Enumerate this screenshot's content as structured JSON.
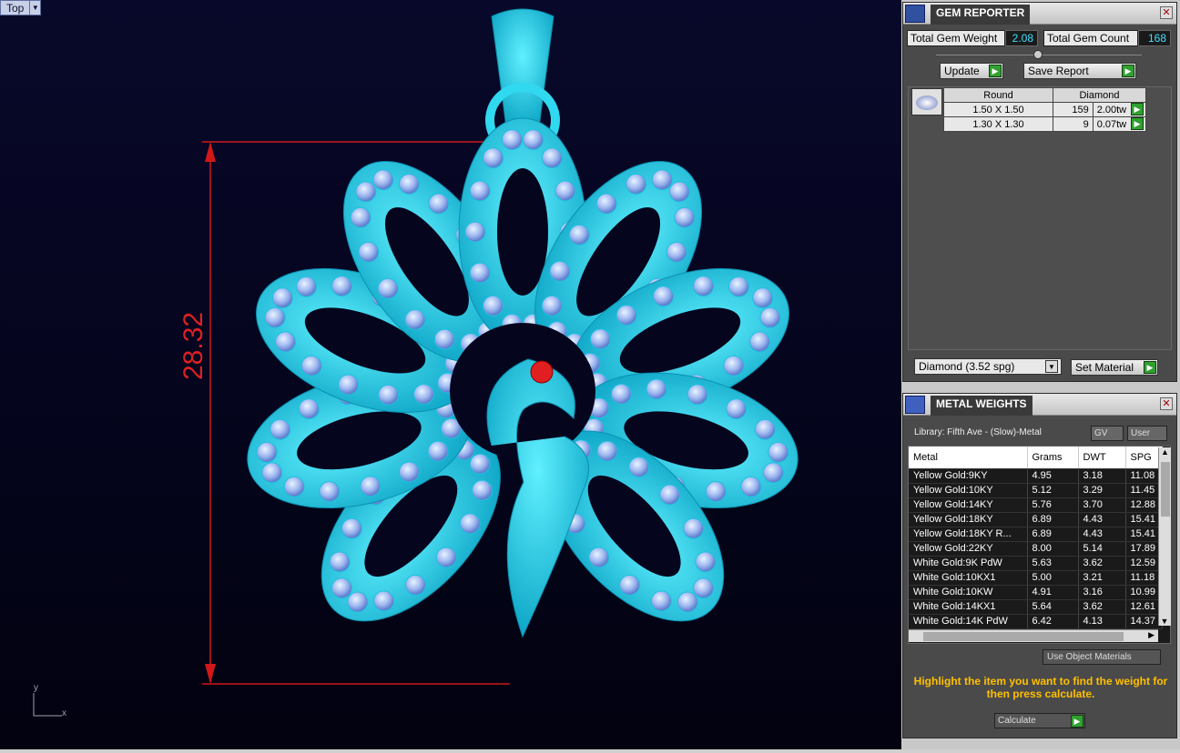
{
  "viewport": {
    "view_name": "Top",
    "dimension": "28.32",
    "axis_y": "y",
    "axis_x": "x"
  },
  "gem_reporter": {
    "title": "GEM REPORTER",
    "total_weight_label": "Total Gem Weight",
    "total_weight_value": "2.08",
    "total_count_label": "Total Gem Count",
    "total_count_value": "168",
    "update_label": "Update",
    "save_label": "Save Report",
    "table_headers": [
      "Round",
      "Diamond"
    ],
    "rows": [
      {
        "size": "1.50 X 1.50",
        "count": "159",
        "weight": "2.00tw"
      },
      {
        "size": "1.30 X 1.30",
        "count": "9",
        "weight": "0.07tw"
      }
    ],
    "material_select": "Diamond    (3.52 spg)",
    "set_material_label": "Set Material"
  },
  "metal_weights": {
    "title": "METAL WEIGHTS",
    "library": "Library: Fifth Ave - (Slow)-Metal",
    "gv_label": "GV",
    "user_label": "User",
    "columns": [
      "Metal",
      "Grams",
      "DWT",
      "SPG"
    ],
    "rows": [
      [
        "Yellow Gold:9KY",
        "4.95",
        "3.18",
        "11.08"
      ],
      [
        "Yellow Gold:10KY",
        "5.12",
        "3.29",
        "11.45"
      ],
      [
        "Yellow Gold:14KY",
        "5.76",
        "3.70",
        "12.88"
      ],
      [
        "Yellow Gold:18KY",
        "6.89",
        "4.43",
        "15.41"
      ],
      [
        "Yellow Gold:18KY R...",
        "6.89",
        "4.43",
        "15.41"
      ],
      [
        "Yellow Gold:22KY",
        "8.00",
        "5.14",
        "17.89"
      ],
      [
        "White Gold:9K PdW",
        "5.63",
        "3.62",
        "12.59"
      ],
      [
        "White Gold:10KX1",
        "5.00",
        "3.21",
        "11.18"
      ],
      [
        "White Gold:10KW",
        "4.91",
        "3.16",
        "10.99"
      ],
      [
        "White Gold:14KX1",
        "5.64",
        "3.62",
        "12.61"
      ],
      [
        "White Gold:14K PdW",
        "6.42",
        "4.13",
        "14.37"
      ]
    ],
    "use_object_label": "Use Object Materials",
    "message": "Highlight the item you want to find the weight for then press calculate.",
    "calculate_label": "Calculate"
  }
}
